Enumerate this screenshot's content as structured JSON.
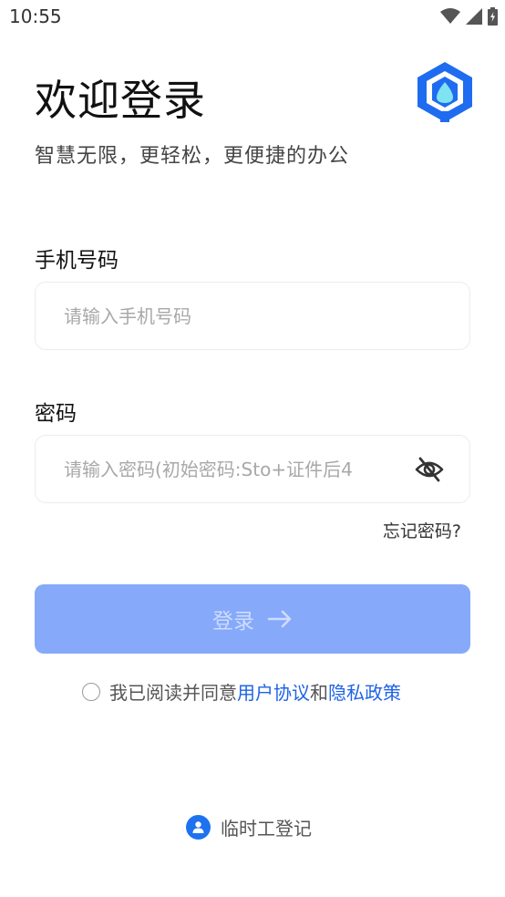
{
  "status_bar": {
    "time": "10:55",
    "icons": [
      "wifi-icon",
      "signal-icon",
      "battery-charging-icon"
    ]
  },
  "header": {
    "title": "欢迎登录",
    "subtitle": "智慧无限，更轻松，更便捷的办公",
    "logo_icon": "cube-logo-icon"
  },
  "form": {
    "phone_label": "手机号码",
    "phone_placeholder": "请输入手机号码",
    "phone_value": "",
    "password_label": "密码",
    "password_placeholder": "请输入密码(初始密码:Sto+证件后4",
    "password_value": "",
    "password_toggle_icon": "eye-off-icon",
    "forgot_label": "忘记密码?",
    "login_label": "登录",
    "login_icon": "arrow-right-icon"
  },
  "agreement": {
    "prefix": "我已阅读并同意",
    "terms_link": "用户协议",
    "connector": "和",
    "privacy_link": "隐私政策",
    "checked": false
  },
  "footer": {
    "temp_register_label": "临时工登记",
    "temp_register_icon": "person-icon"
  },
  "colors": {
    "accent": "#1f63e6",
    "button_disabled": "#86a9fa",
    "logo_blue": "#1f6cf0",
    "logo_cyan": "#7fe3f2"
  }
}
